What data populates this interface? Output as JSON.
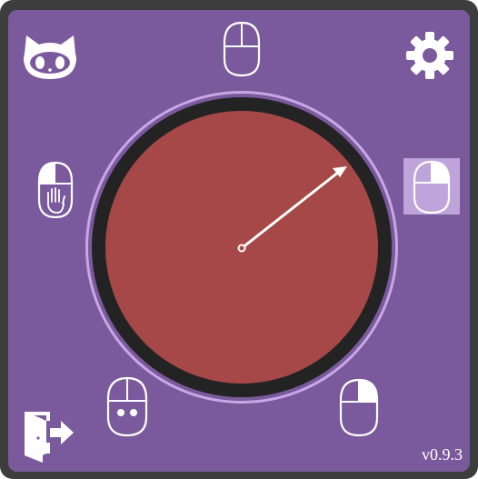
{
  "app": {
    "version": "v0.9.3"
  },
  "colors": {
    "background": "#7a5a9c",
    "frame": "#3d3d3d",
    "dial_face": "#a64848",
    "dial_rim": "#232323",
    "dial_ring": "#c9a6e6",
    "highlight": "#bfa3db",
    "icon": "#ffffff"
  },
  "icons": {
    "top_left": "github-cat-icon",
    "top_right": "gear-icon",
    "bottom_left": "exit-door-icon",
    "mouse_top": "mouse-icon",
    "mouse_left": "mouse-left-click-grab-icon",
    "mouse_right": "mouse-right-click-icon",
    "mouse_bottom_left": "mouse-face-icon",
    "mouse_bottom_right": "mouse-right-button-icon"
  },
  "dial": {
    "pointer_angle_deg": -35
  }
}
